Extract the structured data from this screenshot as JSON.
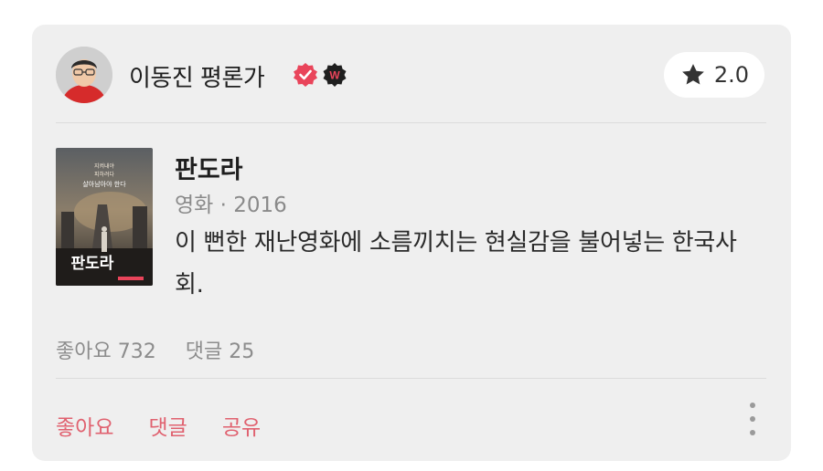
{
  "author": {
    "name": "이동진 평론가",
    "verified_icon": "verified-check-icon",
    "badge_letter": "W",
    "accent": "#e9445a"
  },
  "rating": {
    "value": "2.0",
    "icon": "star-icon"
  },
  "movie": {
    "title": "판도라",
    "meta": "영화 · 2016",
    "poster_title": "판도라"
  },
  "review": {
    "text": "이 뻔한 재난영화에 소름끼치는 현실감을 불어넣는 한국사회."
  },
  "stats": {
    "likes": "좋아요 732",
    "comments": "댓글 25"
  },
  "actions": {
    "like": "좋아요",
    "comment": "댓글",
    "share": "공유"
  }
}
